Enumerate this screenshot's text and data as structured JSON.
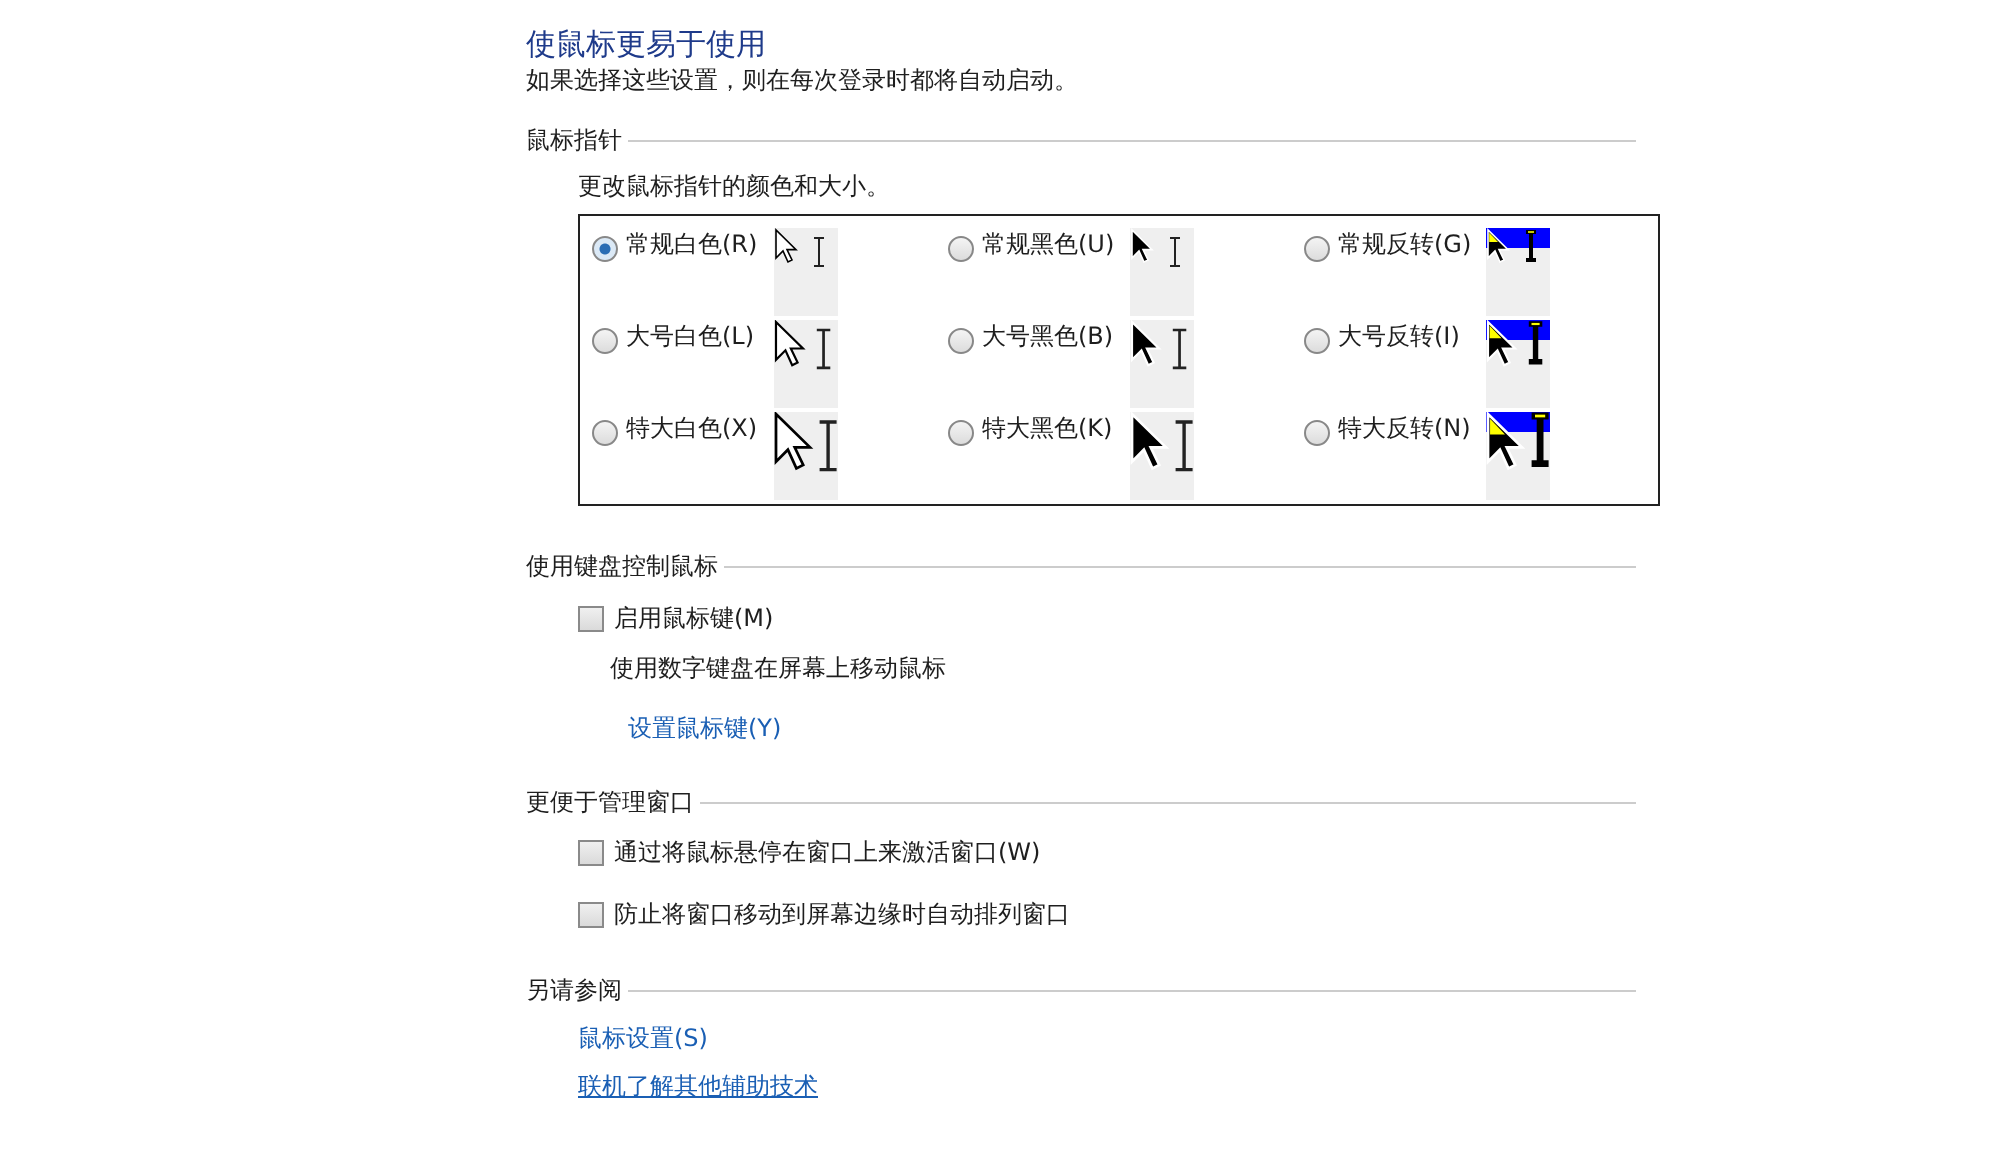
{
  "title": "使鼠标更易于使用",
  "subtitle": "如果选择这些设置，则在每次登录时都将自动启动。",
  "pointer_section": {
    "heading": "鼠标指针",
    "description": "更改鼠标指针的颜色和大小。",
    "rows": [
      {
        "schemes": [
          {
            "label": "常规白色(R)",
            "selected": true,
            "kind": "white"
          },
          {
            "label": "常规黑色(U)",
            "selected": false,
            "kind": "black"
          },
          {
            "label": "常规反转(G)",
            "selected": false,
            "kind": "inverted"
          }
        ]
      },
      {
        "schemes": [
          {
            "label": "大号白色(L)",
            "selected": false,
            "kind": "white"
          },
          {
            "label": "大号黑色(B)",
            "selected": false,
            "kind": "black"
          },
          {
            "label": "大号反转(I)",
            "selected": false,
            "kind": "inverted"
          }
        ]
      },
      {
        "schemes": [
          {
            "label": "特大白色(X)",
            "selected": false,
            "kind": "white"
          },
          {
            "label": "特大黑色(K)",
            "selected": false,
            "kind": "black"
          },
          {
            "label": "特大反转(N)",
            "selected": false,
            "kind": "inverted"
          }
        ]
      }
    ]
  },
  "keyboard_section": {
    "heading": "使用键盘控制鼠标",
    "checkbox": {
      "label": "启用鼠标键(M)",
      "checked": false
    },
    "description": "使用数字键盘在屏幕上移动鼠标",
    "link": "设置鼠标键(Y)"
  },
  "window_section": {
    "heading": "更便于管理窗口",
    "checkboxes": [
      {
        "label": "通过将鼠标悬停在窗口上来激活窗口(W)",
        "checked": false
      },
      {
        "label": "防止将窗口移动到屏幕边缘时自动排列窗口",
        "checked": false
      }
    ]
  },
  "see_also": {
    "heading": "另请参阅",
    "links": [
      {
        "label": "鼠标设置(S)",
        "underlined": false
      },
      {
        "label": "联机了解其他辅助技术",
        "underlined": true
      }
    ]
  }
}
